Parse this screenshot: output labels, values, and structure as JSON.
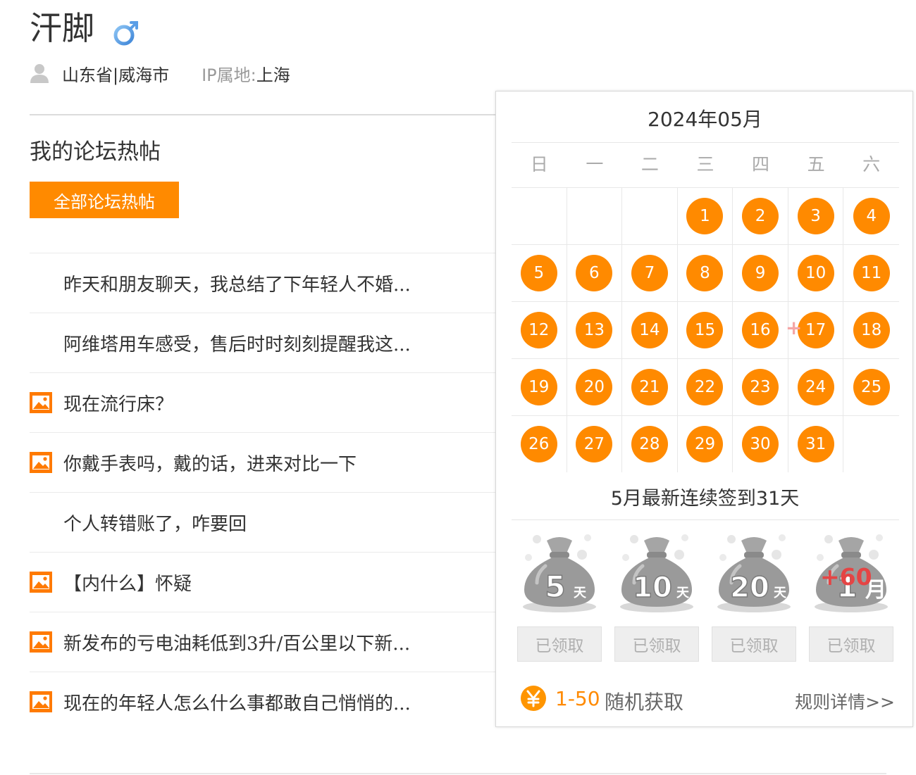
{
  "profile": {
    "name": "汗脚",
    "gender_icon": "male-symbol-icon",
    "location": "山东省|威海市",
    "ip_label": "IP属地:",
    "ip_value": "上海"
  },
  "forum": {
    "section_title": "我的论坛热帖",
    "all_button": "全部论坛热帖",
    "posts": [
      {
        "title": "昨天和朋友聊天，我总结了下年轻人不婚...",
        "has_image": false
      },
      {
        "title": "阿维塔用车感受，售后时时刻刻提醒我这...",
        "has_image": false
      },
      {
        "title": "现在流行床？",
        "has_image": true
      },
      {
        "title": "你戴手表吗，戴的话，进来对比一下",
        "has_image": true
      },
      {
        "title": "个人转错账了，咋要回",
        "has_image": false
      },
      {
        "title": "【内什么】怀疑",
        "has_image": true
      },
      {
        "title": "新发布的亏电油耗低到3升/百公里以下新...",
        "has_image": true
      },
      {
        "title": "现在的年轻人怎么什么事都敢自己悄悄的...",
        "has_image": true
      }
    ]
  },
  "calendar": {
    "month_label": "2024年05月",
    "weekdays": [
      "日",
      "一",
      "二",
      "三",
      "四",
      "五",
      "六"
    ],
    "weeks": [
      [
        "",
        "",
        "",
        "1",
        "2",
        "3",
        "4"
      ],
      [
        "5",
        "6",
        "7",
        "8",
        "9",
        "10",
        "11"
      ],
      [
        "12",
        "13",
        "14",
        "15",
        "16",
        "17",
        "18"
      ],
      [
        "19",
        "20",
        "21",
        "22",
        "23",
        "24",
        "25"
      ],
      [
        "26",
        "27",
        "28",
        "29",
        "30",
        "31",
        ""
      ]
    ],
    "plus_mark": "+",
    "streak_text": "5月最新连续签到31天",
    "rewards": [
      {
        "days": "5",
        "unit": "天",
        "button": "已领取"
      },
      {
        "days": "10",
        "unit": "天",
        "button": "已领取"
      },
      {
        "days": "20",
        "unit": "天",
        "button": "已领取"
      },
      {
        "days": "1",
        "unit": "月",
        "bonus": "+60",
        "button": "已领取"
      }
    ],
    "random_range": "1-50",
    "random_text": "随机获取",
    "rules_link": "规则详情>>",
    "accent_color": "#ff8a00"
  }
}
